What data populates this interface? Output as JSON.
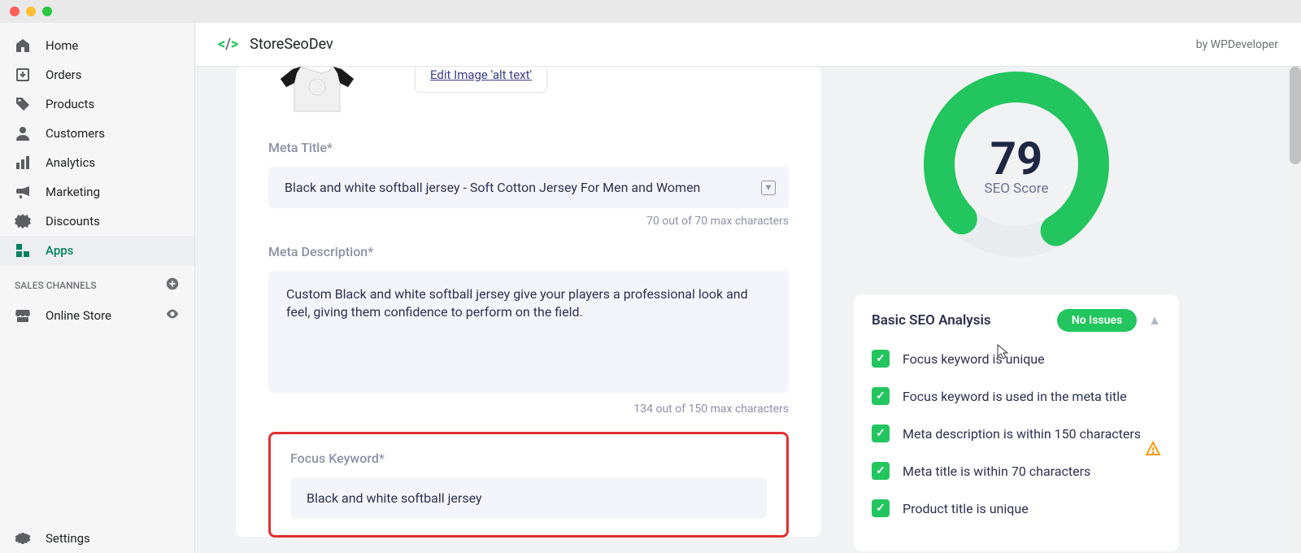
{
  "app": {
    "name": "StoreSeoDev",
    "by_text": "by WPDeveloper"
  },
  "sidebar": {
    "items": [
      {
        "label": "Home"
      },
      {
        "label": "Orders"
      },
      {
        "label": "Products"
      },
      {
        "label": "Customers"
      },
      {
        "label": "Analytics"
      },
      {
        "label": "Marketing"
      },
      {
        "label": "Discounts"
      },
      {
        "label": "Apps"
      }
    ],
    "channels_header": "SALES CHANNELS",
    "online_store": "Online Store",
    "settings": "Settings"
  },
  "form": {
    "edit_image_link": "Edit Image 'alt text'",
    "meta_title_label": "Meta Title*",
    "meta_title_value": "Black and white softball jersey - Soft Cotton Jersey For Men and Women",
    "meta_title_count": "70 out of 70 max characters",
    "meta_desc_label": "Meta Description*",
    "meta_desc_value": "Custom Black and white softball jersey give your players a professional look and feel, giving them confidence to perform on the field.",
    "meta_desc_count": "134 out of 150 max characters",
    "focus_keyword_label": "Focus Keyword*",
    "focus_keyword_value": "Black and white softball jersey"
  },
  "seo": {
    "score": "79",
    "score_label": "SEO Score",
    "analysis_title": "Basic SEO Analysis",
    "no_issues": "No Issues",
    "checks": [
      {
        "text": "Focus keyword is unique"
      },
      {
        "text": "Focus keyword is used in the meta title"
      },
      {
        "text": "Meta description is within 150 characters",
        "warning": true
      },
      {
        "text": "Meta title is within 70 characters"
      },
      {
        "text": "Product title is unique"
      }
    ]
  }
}
